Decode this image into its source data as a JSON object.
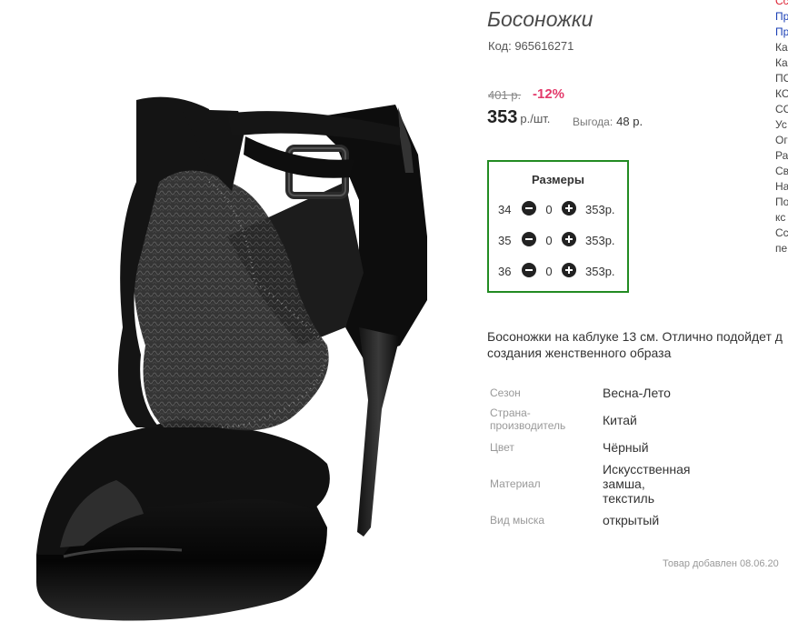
{
  "product": {
    "title": "Босоножки",
    "code": "Код: 965616271",
    "old_price": "401 р.",
    "discount": "-12%",
    "price": "353",
    "price_unit": "р./шт.",
    "benefit_label": "Выгода:",
    "benefit_value": "48 р."
  },
  "sizes": {
    "title": "Размеры",
    "rows": [
      {
        "size": "34",
        "qty": "0",
        "price": "353р."
      },
      {
        "size": "35",
        "qty": "0",
        "price": "353р."
      },
      {
        "size": "36",
        "qty": "0",
        "price": "353р."
      }
    ]
  },
  "description": {
    "line1": "Босоножки на каблуке 13 см. Отлично подойдет д",
    "line2": "создания женственного образа"
  },
  "attributes": [
    {
      "label": "Сезон",
      "value": "Весна-Лето"
    },
    {
      "label1": "Страна-",
      "label2": "производитель",
      "value": "Китай"
    },
    {
      "label": "Цвет",
      "value": "Чёрный"
    },
    {
      "label": "Материал",
      "v1": "Искусственная",
      "v2": "замша,",
      "v3": "текстиль"
    },
    {
      "label": "Вид мыска",
      "value": "открытый"
    }
  ],
  "added": "Товар добавлен 08.06.20",
  "side_menu": [
    "Сс",
    "Пр",
    "Пр",
    "Ка",
    "Ка",
    "ПС",
    "КС",
    "СС",
    "Ус",
    "Ог",
    "Ра",
    "Св",
    "На",
    "По",
    "кс",
    "Сс",
    "пе"
  ],
  "colors": {
    "discount": "#e3396a",
    "sizes_border": "#228b22",
    "link_blue": "#1a3fb5",
    "link_red": "#d23"
  }
}
